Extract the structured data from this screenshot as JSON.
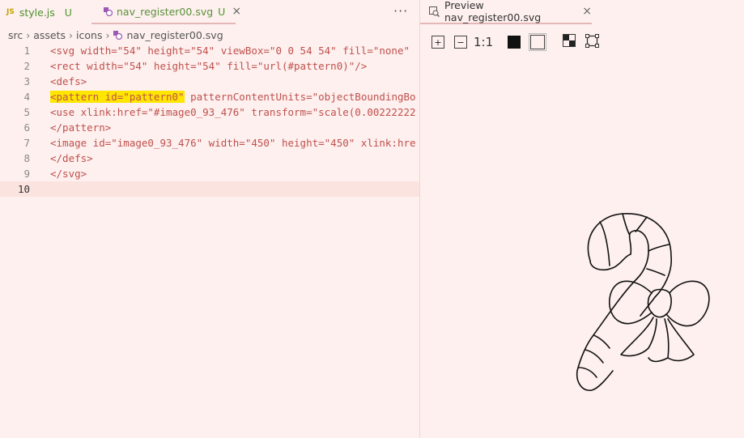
{
  "tabs": [
    {
      "icon": "JS",
      "label": "style.js",
      "status": "U"
    },
    {
      "label": "nav_register00.svg",
      "status": "U",
      "close": "×"
    }
  ],
  "more_label": "···",
  "breadcrumb": [
    "src",
    "assets",
    "icons",
    "nav_register00.svg"
  ],
  "code_lines": [
    {
      "n": "1",
      "parts": [
        "<svg width=\"54\" height=\"54\" viewBox=\"0 0 54 54\" fill=\"none\""
      ]
    },
    {
      "n": "2",
      "parts": [
        "<rect width=\"54\" height=\"54\" fill=\"url(#pattern0)\"/>"
      ]
    },
    {
      "n": "3",
      "parts": [
        "<defs>"
      ]
    },
    {
      "n": "4",
      "highlight": "<pattern id=\"pattern0\"",
      "rest": " patternContentUnits=\"objectBoundingBo"
    },
    {
      "n": "5",
      "parts": [
        "<use xlink:href=\"#image0_93_476\" transform=\"scale(0.00222222"
      ]
    },
    {
      "n": "6",
      "parts": [
        "</pattern>"
      ]
    },
    {
      "n": "7",
      "parts": [
        "<image id=\"image0_93_476\" width=\"450\" height=\"450\" xlink:hre"
      ]
    },
    {
      "n": "8",
      "parts": [
        "</defs>"
      ]
    },
    {
      "n": "9",
      "parts": [
        "</svg>"
      ]
    },
    {
      "n": "10",
      "parts": [
        ""
      ]
    }
  ],
  "preview_tab": {
    "label": "Preview nav_register00.svg",
    "close": "×"
  },
  "toolbar": {
    "zoom_in": "+",
    "zoom_out": "−",
    "one_to_one": "1:1"
  },
  "colors": {
    "accent_tab": "#e5b8b8",
    "bg": "#fdf0ee",
    "highlight": "#ffe600"
  },
  "art_icon": "candy-cane-with-bow"
}
